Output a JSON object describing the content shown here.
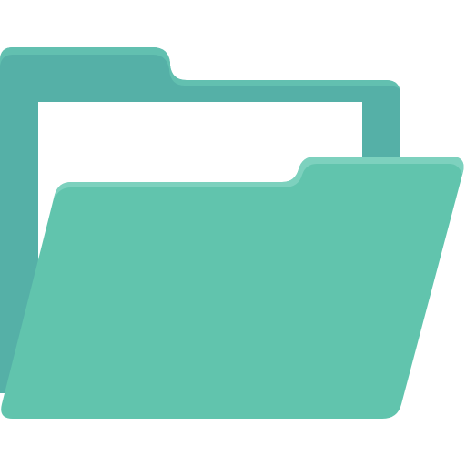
{
  "icon": {
    "name": "open-folder-icon",
    "colors": {
      "back_panel": "#55B0A7",
      "back_panel_highlight": "#62C0B0",
      "paper": "#FFFFFF",
      "front_panel": "#61C4AD",
      "front_panel_highlight": "#7DD1BE"
    }
  }
}
